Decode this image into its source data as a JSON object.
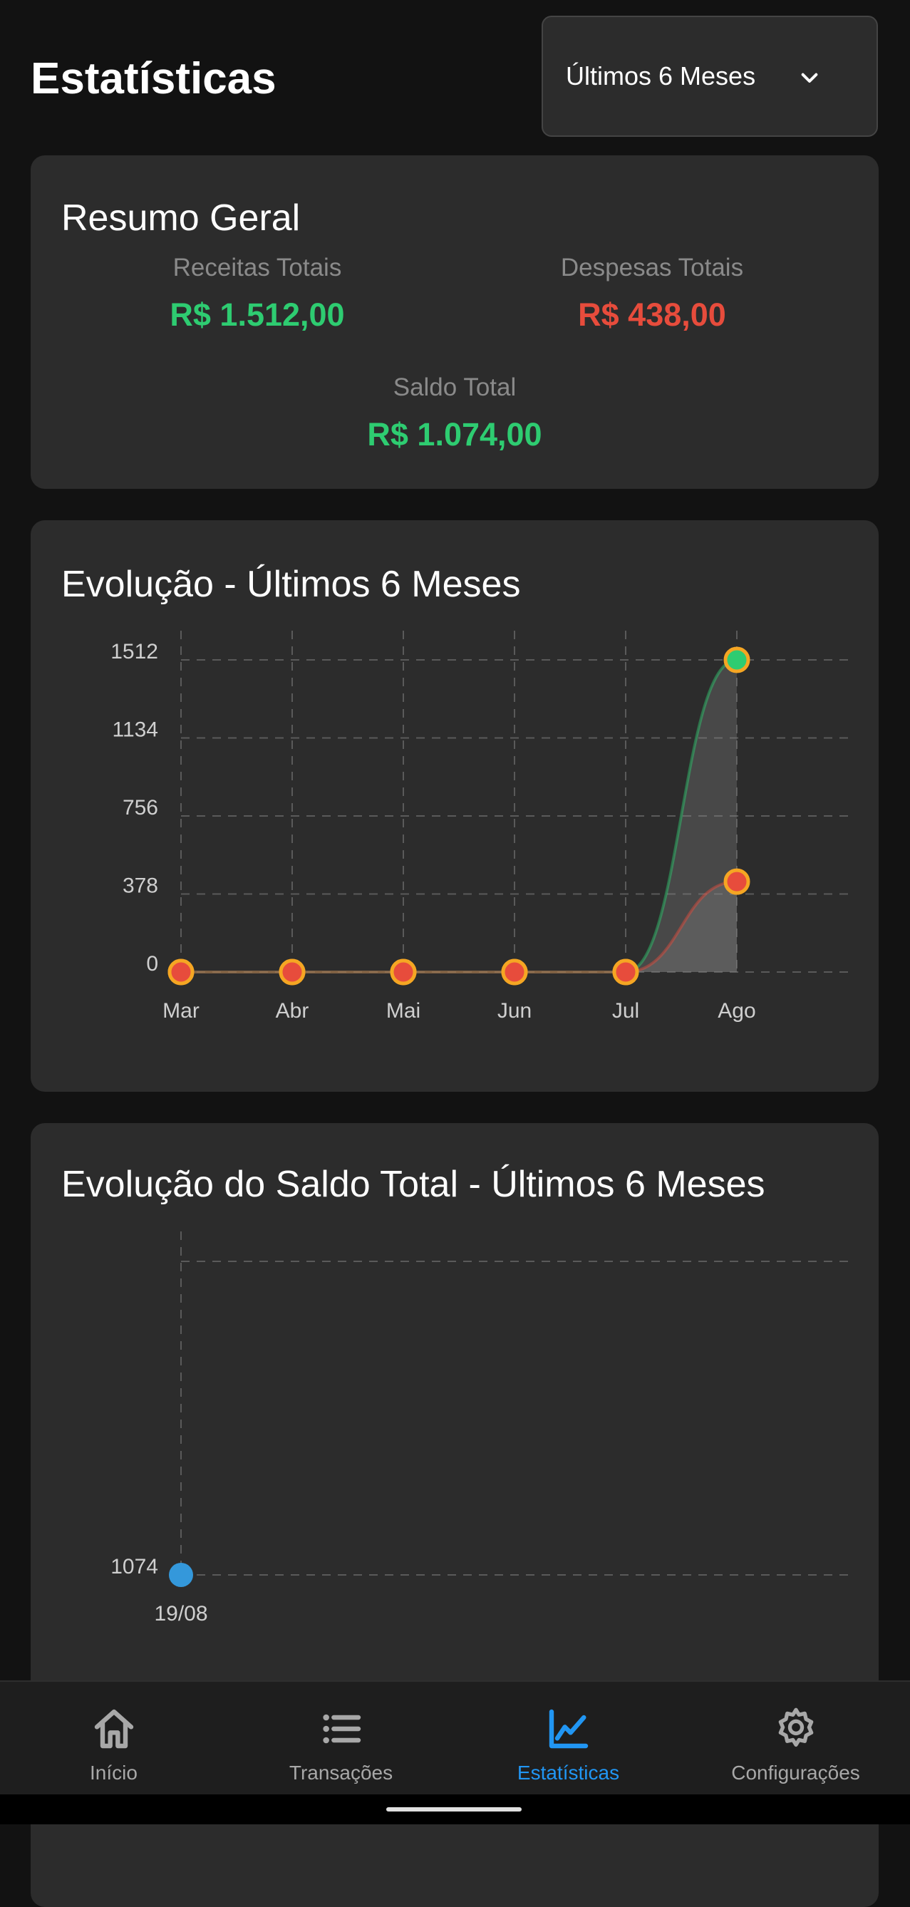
{
  "header": {
    "title": "Estatísticas"
  },
  "period_select": {
    "value": "Últimos 6 Meses"
  },
  "summary": {
    "title": "Resumo Geral",
    "receitas_label": "Receitas Totais",
    "receitas_value": "R$ 1.512,00",
    "despesas_label": "Despesas Totais",
    "despesas_value": "R$ 438,00",
    "saldo_label": "Saldo Total",
    "saldo_value": "R$ 1.074,00"
  },
  "colors": {
    "income": "#2ecc71",
    "expense": "#e74c3c",
    "point_border": "#f5a623",
    "balance": "#3498db",
    "active_nav": "#2196f3"
  },
  "evolution_chart": {
    "title": "Evolução - Últimos 6 Meses",
    "chart_data": {
      "type": "line",
      "categories": [
        "Mar",
        "Abr",
        "Mai",
        "Jun",
        "Jul",
        "Ago"
      ],
      "series": [
        {
          "values": [
            0,
            0,
            0,
            0,
            0,
            1512
          ]
        },
        {
          "values": [
            0,
            0,
            0,
            0,
            0,
            438
          ]
        }
      ],
      "yticks": [
        0,
        378,
        756,
        1134,
        1512
      ],
      "ylim": [
        0,
        1512
      ],
      "grid": true
    }
  },
  "balance_chart": {
    "title": "Evolução do Saldo Total - Últimos 6 Meses",
    "chart_data": {
      "type": "line",
      "categories": [
        "19/08"
      ],
      "values": [
        1074
      ],
      "yticks": [
        1074
      ],
      "grid": true
    }
  },
  "bottom_nav": {
    "items": [
      {
        "label": "Início",
        "icon": "home-icon"
      },
      {
        "label": "Transações",
        "icon": "list-icon"
      },
      {
        "label": "Estatísticas",
        "icon": "chart-icon",
        "active": true
      },
      {
        "label": "Configurações",
        "icon": "gear-icon"
      }
    ]
  }
}
